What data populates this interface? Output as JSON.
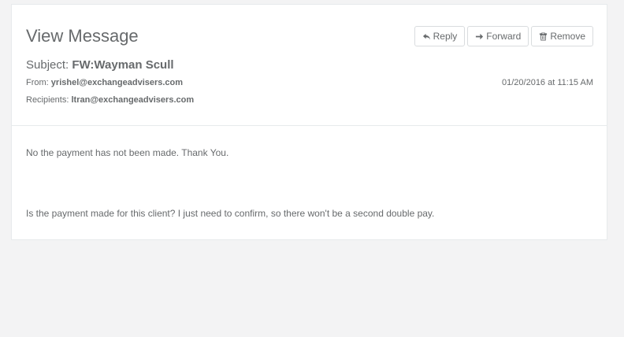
{
  "page": {
    "title": "View Message"
  },
  "toolbar": {
    "reply_label": "Reply",
    "reply_icon": "reply-icon",
    "forward_label": "Forward",
    "forward_icon": "arrow-right-icon",
    "remove_label": "Remove",
    "remove_icon": "trash-icon"
  },
  "message": {
    "subject_label": "Subject:",
    "subject": "FW:Wayman Scull",
    "from_label": "From:",
    "from": "yrishel@exchangeadvisers.com",
    "recipients_label": "Recipients:",
    "recipients": "ltran@exchangeadvisers.com",
    "timestamp": "01/20/2016 at 11:15 AM",
    "body": [
      "No the payment has not been made. Thank You.",
      "Is the payment made for this client? I just need to confirm, so there won't be a second double pay."
    ]
  },
  "colors": {
    "background": "#f3f3f4",
    "panel": "#ffffff",
    "text": "#676a6c",
    "border": "#e7eaec"
  }
}
